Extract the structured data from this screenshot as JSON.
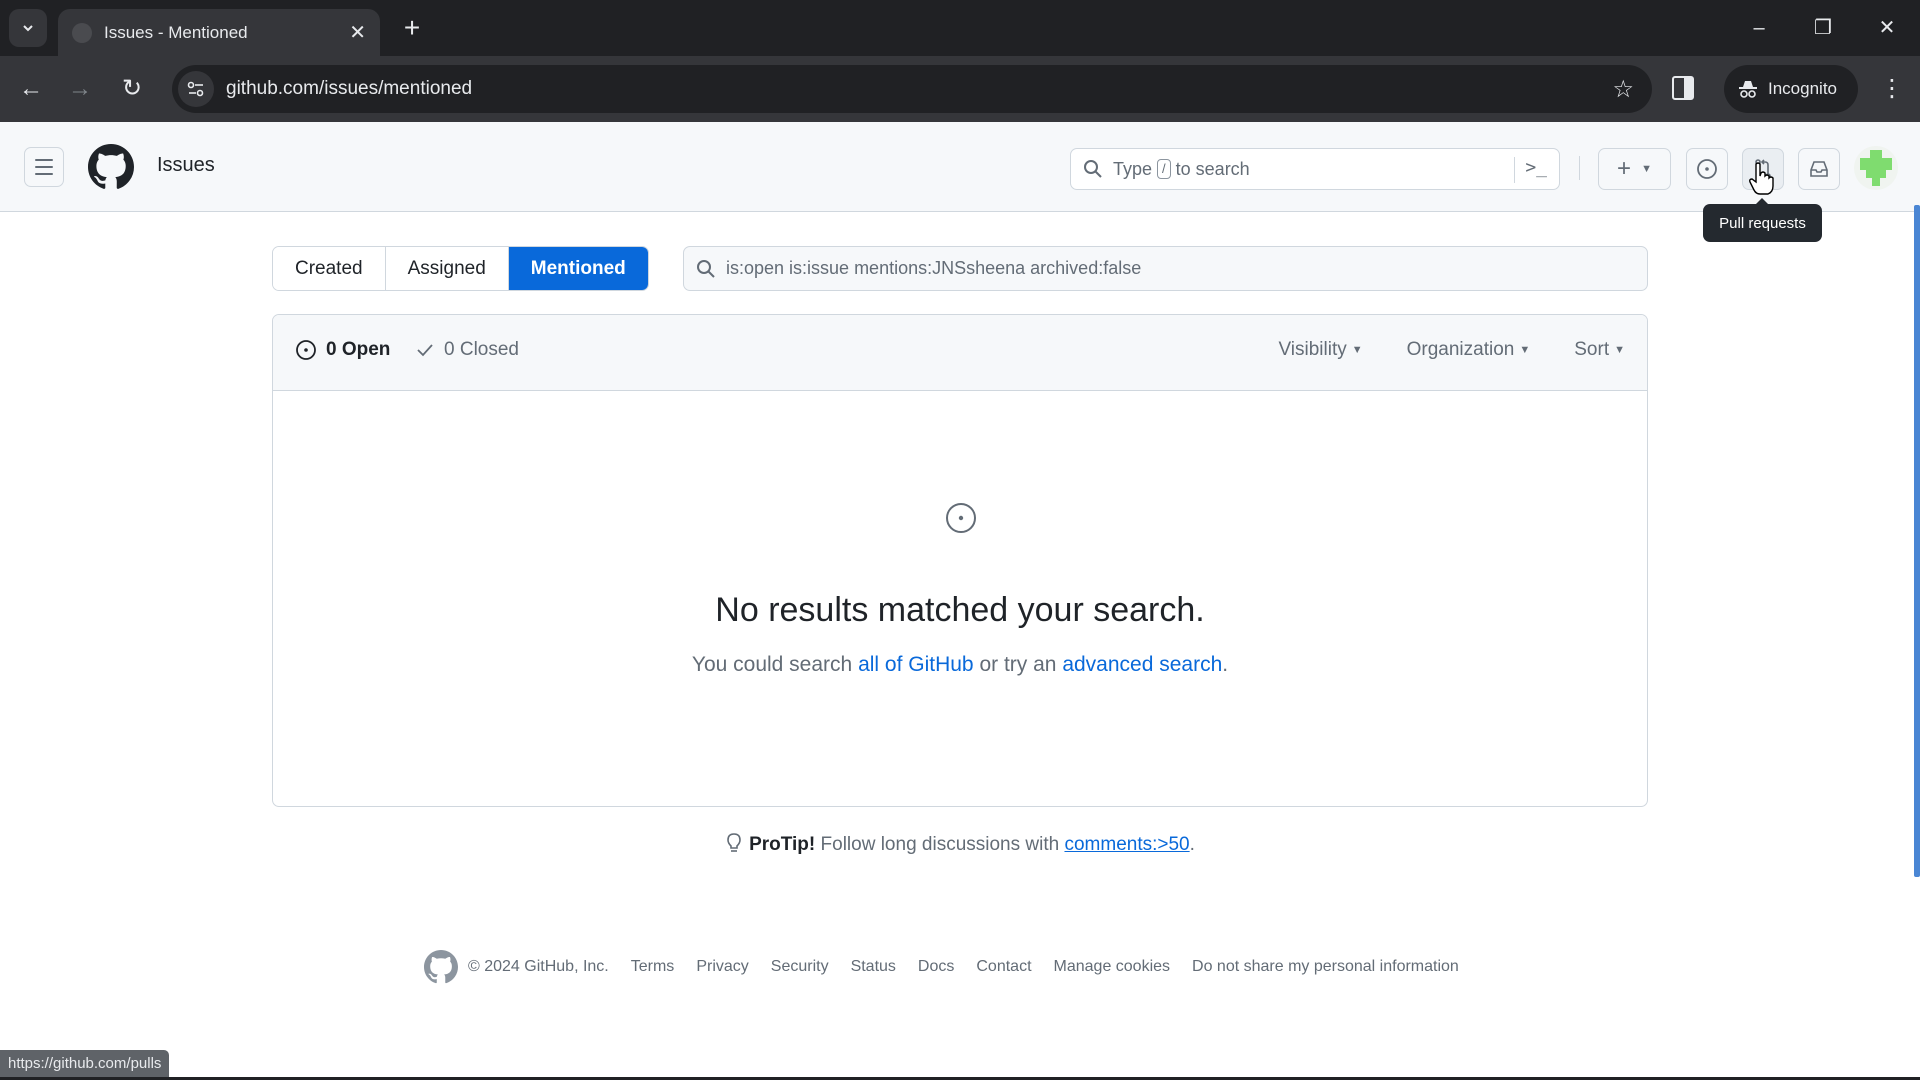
{
  "browser": {
    "tab_title": "Issues - Mentioned",
    "url": "github.com/issues/mentioned",
    "incognito_label": "Incognito",
    "status_url": "https://github.com/pulls"
  },
  "header": {
    "context_title": "Issues",
    "search_prefix": "Type",
    "search_kbd": "/",
    "search_suffix": "to search",
    "tooltip": "Pull requests",
    "icons": [
      "menu-icon",
      "github-logo",
      "search-icon",
      "command-palette-icon",
      "plus-icon",
      "issue-icon",
      "pull-request-icon",
      "inbox-icon",
      "avatar"
    ]
  },
  "tabs": [
    {
      "label": "Created",
      "selected": false
    },
    {
      "label": "Assigned",
      "selected": false
    },
    {
      "label": "Mentioned",
      "selected": true
    }
  ],
  "filter": {
    "value": "is:open is:issue mentions:JNSsheena archived:false"
  },
  "results": {
    "open_label": "0 Open",
    "closed_label": "0 Closed",
    "dropdowns": [
      "Visibility",
      "Organization",
      "Sort"
    ],
    "empty_title": "No results matched your search.",
    "empty_desc_1": "You could search ",
    "empty_link_1": "all of GitHub",
    "empty_desc_2": " or try an ",
    "empty_link_2": "advanced search",
    "empty_desc_3": "."
  },
  "protip": {
    "bold": "ProTip!",
    "text": " Follow long discussions with ",
    "link": "comments:>50",
    "end": "."
  },
  "footer": {
    "copyright": "© 2024 GitHub, Inc.",
    "links": [
      "Terms",
      "Privacy",
      "Security",
      "Status",
      "Docs",
      "Contact",
      "Manage cookies",
      "Do not share my personal information"
    ]
  },
  "colors": {
    "accent": "#0969da",
    "header_bg": "#f6f8fa",
    "chrome_bg": "#202124"
  }
}
